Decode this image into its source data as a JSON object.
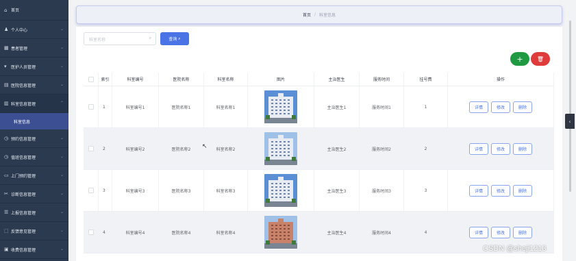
{
  "sidebar": {
    "items": [
      {
        "icon": "home-icon",
        "glyph": "⌂",
        "label": "首页",
        "chevron": false
      },
      {
        "icon": "user-icon",
        "glyph": "♟",
        "label": "个人中心",
        "chevron": true
      },
      {
        "icon": "patient-icon",
        "glyph": "▦",
        "label": "患者管理",
        "chevron": true
      },
      {
        "icon": "staff-icon",
        "glyph": "▾",
        "label": "医护人员管理",
        "chevron": true
      },
      {
        "icon": "hospital-icon",
        "glyph": "▤",
        "label": "医院信息管理",
        "chevron": true
      },
      {
        "icon": "department-icon",
        "glyph": "▥",
        "label": "科室信息管理",
        "chevron": true,
        "open": true,
        "sub": [
          "科室信息"
        ]
      },
      {
        "icon": "clock-icon",
        "glyph": "◷",
        "label": "预约信息管理",
        "chevron": true
      },
      {
        "icon": "clock-icon",
        "glyph": "◷",
        "label": "值班信息管理",
        "chevron": true
      },
      {
        "icon": "calendar-icon",
        "glyph": "▭",
        "label": "上门预约管理",
        "chevron": true
      },
      {
        "icon": "diagnosis-icon",
        "glyph": "✂",
        "label": "诊断信息管理",
        "chevron": true
      },
      {
        "icon": "report-icon",
        "glyph": "☰",
        "label": "上报信息管理",
        "chevron": true
      },
      {
        "icon": "feedback-icon",
        "glyph": "⬚",
        "label": "反馈意见管理",
        "chevron": true
      },
      {
        "icon": "fee-icon",
        "glyph": "▣",
        "label": "收费信息管理",
        "chevron": true
      }
    ]
  },
  "breadcrumb": {
    "home": "首页",
    "separator": "/",
    "current": "科室信息"
  },
  "search": {
    "placeholder": "科室名称",
    "button_label": "查询"
  },
  "actions": {
    "add_label": "+",
    "delete_label": "🗑"
  },
  "table": {
    "headers": [
      "",
      "索引",
      "科室编号",
      "医院名称",
      "科室名称",
      "图片",
      "主治医生",
      "服务时间",
      "挂号费",
      "操作"
    ],
    "rows": [
      {
        "index": "1",
        "code": "科室编号1",
        "hospital": "医院名称1",
        "dept": "科室名称1",
        "doctor": "主治医生1",
        "time": "服务时间1",
        "fee": "1"
      },
      {
        "index": "2",
        "code": "科室编号2",
        "hospital": "医院名称2",
        "dept": "科室名称2",
        "doctor": "主治医生2",
        "time": "服务时间2",
        "fee": "2"
      },
      {
        "index": "3",
        "code": "科室编号3",
        "hospital": "医院名称3",
        "dept": "科室名称3",
        "doctor": "主治医生3",
        "time": "服务时间3",
        "fee": "3"
      },
      {
        "index": "4",
        "code": "科室编号4",
        "hospital": "医院名称4",
        "dept": "科室名称4",
        "doctor": "主治医生4",
        "time": "服务时间4",
        "fee": "4"
      }
    ],
    "row_actions": {
      "detail": "详情",
      "edit": "修改",
      "delete": "删除"
    }
  },
  "watermark": "CSDN @sheji1213",
  "colors": {
    "sidebar_bg": "#2b3a4f",
    "sidebar_active": "#3c4f93",
    "primary": "#4a73e6",
    "add": "#1f9a43",
    "delete": "#e03b3b"
  }
}
